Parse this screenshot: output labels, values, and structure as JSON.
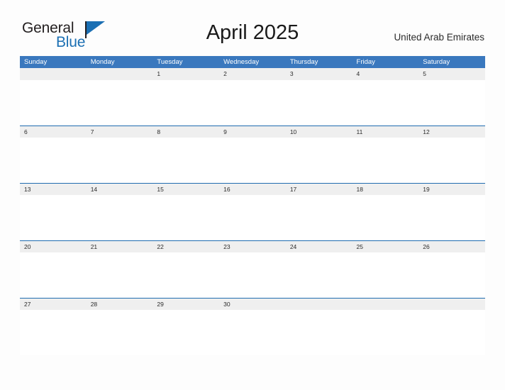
{
  "brand": {
    "name_part1": "General",
    "name_part2": "Blue",
    "flag_icon": "triangle-flag-icon",
    "accent_color": "#1b6fb3"
  },
  "header": {
    "title": "April 2025",
    "country": "United Arab Emirates"
  },
  "calendar": {
    "header_bg": "#3a78be",
    "date_strip_bg": "#efefef",
    "separator_color": "#1f6cb0",
    "weekdays": [
      "Sunday",
      "Monday",
      "Tuesday",
      "Wednesday",
      "Thursday",
      "Friday",
      "Saturday"
    ],
    "weeks": [
      [
        "",
        "",
        "1",
        "2",
        "3",
        "4",
        "5"
      ],
      [
        "6",
        "7",
        "8",
        "9",
        "10",
        "11",
        "12"
      ],
      [
        "13",
        "14",
        "15",
        "16",
        "17",
        "18",
        "19"
      ],
      [
        "20",
        "21",
        "22",
        "23",
        "24",
        "25",
        "26"
      ],
      [
        "27",
        "28",
        "29",
        "30",
        "",
        "",
        ""
      ]
    ]
  }
}
